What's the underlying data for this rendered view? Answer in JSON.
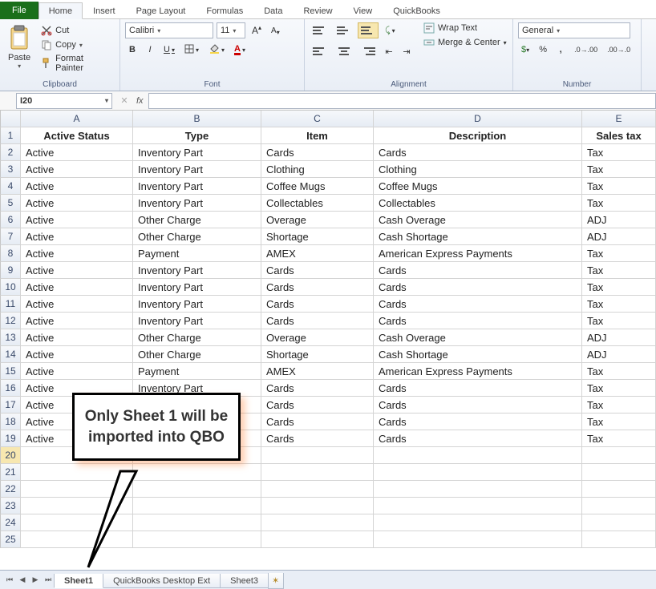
{
  "ribbon": {
    "tabs": [
      "File",
      "Home",
      "Insert",
      "Page Layout",
      "Formulas",
      "Data",
      "Review",
      "View",
      "QuickBooks"
    ],
    "active_tab": "Home",
    "clipboard": {
      "title": "Clipboard",
      "paste": "Paste",
      "cut": "Cut",
      "copy": "Copy",
      "format_painter": "Format Painter"
    },
    "font": {
      "title": "Font",
      "name": "Calibri",
      "size": "11",
      "bold": "B",
      "italic": "I",
      "underline": "U"
    },
    "alignment": {
      "title": "Alignment",
      "wrap": "Wrap Text",
      "merge": "Merge & Center"
    },
    "number": {
      "title": "Number",
      "format": "General"
    }
  },
  "namebox": "I20",
  "columns": [
    "A",
    "B",
    "C",
    "D",
    "E"
  ],
  "headers": [
    "Active Status",
    "Type",
    "Item",
    "Description",
    "Sales tax"
  ],
  "rows": [
    [
      "Active",
      "Inventory Part",
      "Cards",
      "Cards",
      "Tax"
    ],
    [
      "Active",
      "Inventory Part",
      "Clothing",
      "Clothing",
      "Tax"
    ],
    [
      "Active",
      "Inventory Part",
      "Coffee Mugs",
      "Coffee Mugs",
      "Tax"
    ],
    [
      "Active",
      "Inventory Part",
      "Collectables",
      "Collectables",
      "Tax"
    ],
    [
      "Active",
      "Other Charge",
      "Overage",
      "Cash Overage",
      "ADJ"
    ],
    [
      "Active",
      "Other Charge",
      "Shortage",
      "Cash Shortage",
      "ADJ"
    ],
    [
      "Active",
      "Payment",
      "AMEX",
      "American Express Payments",
      "Tax"
    ],
    [
      "Active",
      "Inventory Part",
      "Cards",
      "Cards",
      "Tax"
    ],
    [
      "Active",
      "Inventory Part",
      "Cards",
      "Cards",
      "Tax"
    ],
    [
      "Active",
      "Inventory Part",
      "Cards",
      "Cards",
      "Tax"
    ],
    [
      "Active",
      "Inventory Part",
      "Cards",
      "Cards",
      "Tax"
    ],
    [
      "Active",
      "Other Charge",
      "Overage",
      "Cash Overage",
      "ADJ"
    ],
    [
      "Active",
      "Other Charge",
      "Shortage",
      "Cash Shortage",
      "ADJ"
    ],
    [
      "Active",
      "Payment",
      "AMEX",
      "American Express Payments",
      "Tax"
    ],
    [
      "Active",
      "Inventory Part",
      "Cards",
      "Cards",
      "Tax"
    ],
    [
      "Active",
      "",
      "Cards",
      "Cards",
      "Tax"
    ],
    [
      "Active",
      "",
      "Cards",
      "Cards",
      "Tax"
    ],
    [
      "Active",
      "",
      "Cards",
      "Cards",
      "Tax"
    ]
  ],
  "empty_rows": [
    20,
    21,
    22,
    23,
    24,
    25
  ],
  "sheet_tabs": {
    "active": "Sheet1",
    "tabs": [
      "Sheet1",
      "QuickBooks Desktop Ext",
      "Sheet3"
    ]
  },
  "callout_text": "Only Sheet 1 will be imported into QBO"
}
